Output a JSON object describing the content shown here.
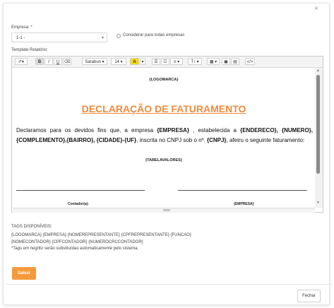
{
  "modal": {
    "close_glyph": "×"
  },
  "form": {
    "empresa_label": "Empresa: *",
    "empresa_value": "1-1 -",
    "empresa_caret": "▾",
    "empresa_sep": ".",
    "consider_all_label": "Considerar para todas empresas",
    "template_label": "Template Relatório:"
  },
  "toolbar": {
    "magic": "✐▾",
    "bold": "B",
    "italic": "I",
    "underline": "U",
    "eraser": "⌫",
    "font": "Sarabun ▾",
    "size": "14 ▾",
    "color": "A",
    "color_caret": "▾",
    "ul": "☰",
    "ol": "☷",
    "align": "≡ ▾",
    "height": "T↕ ▾",
    "table": "▦ ▾",
    "picture": "▣",
    "video": "▤",
    "code": "</>"
  },
  "document": {
    "logo": "{LOGOMARCA}",
    "title": "DECLARAÇÃO DE FATURAMENTO",
    "p_text1": "Declaramos para os devidos fins que, a empresa ",
    "p_b1": "{EMPRESA}",
    "p_text2": " , estabelecida a ",
    "p_b2": "{ENDERECO}, {NUMERO}, {COMPLEMENTO},{BAIRRO}, {CIDADE}-{UF}",
    "p_text3": ", inscrita no CNPJ sob o nº. ",
    "p_b3": "{CNPJ}",
    "p_text4": ", afeiru o seguinte faturamento:",
    "table_values": "{TABELAVALORES}",
    "sig_left": "Contador(a):",
    "sig_right": "{EMPRESA}"
  },
  "tags": {
    "heading": "TAGS DISPONÍVEIS:",
    "line1": "{LOGOMARCA} {EMPRESA} {NOMEREPRESENTANTE} {CPFREPRESENTANTE} {FUNCAO}",
    "line2": "{NOMECONTADOR} {CPFCONTADOR} {NUMEROCRCCONTADOR}",
    "note": "*Tags em negrito serão substituídas automaticamente pelo sistema."
  },
  "buttons": {
    "save": "Salvar",
    "close": "Fechar"
  },
  "colors": {
    "accent": "#f59a3c",
    "title": "#f08a3c",
    "highlight": "#f5d90a"
  }
}
